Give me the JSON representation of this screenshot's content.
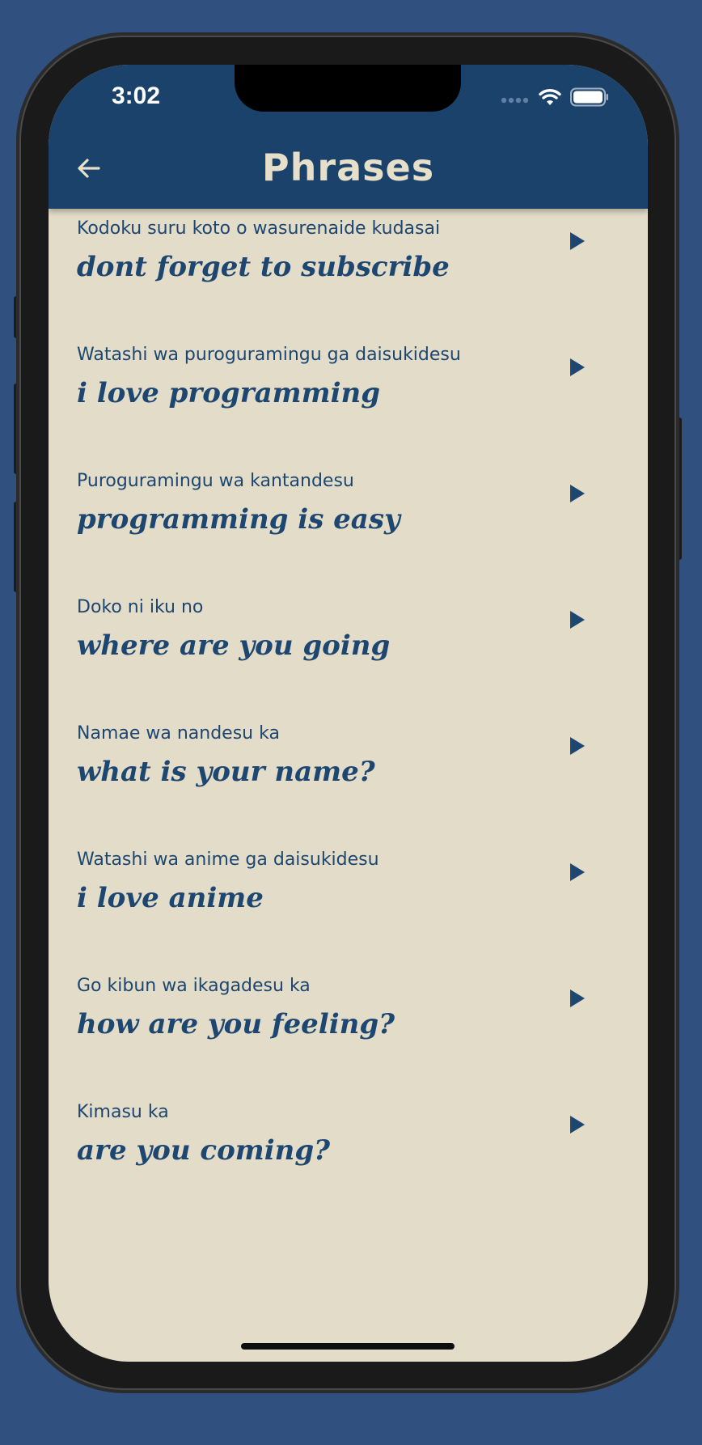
{
  "status_bar": {
    "time": "3:02"
  },
  "header": {
    "title": "Phrases",
    "back_icon": "arrow-left-icon"
  },
  "phrases": [
    {
      "romaji": "Kodoku suru koto o wasurenaide kudasai",
      "english": "dont forget to subscribe"
    },
    {
      "romaji": "Watashi wa puroguramingu ga daisukidesu",
      "english": "i love programming"
    },
    {
      "romaji": "Puroguramingu wa kantandesu",
      "english": "programming is easy"
    },
    {
      "romaji": "Doko ni iku no",
      "english": "where are you going"
    },
    {
      "romaji": "Namae wa nandesu ka",
      "english": "what is your name?"
    },
    {
      "romaji": "Watashi wa anime ga daisukidesu",
      "english": "i love anime"
    },
    {
      "romaji": "Go kibun wa ikagadesu ka",
      "english": "how are you feeling?"
    },
    {
      "romaji": "Kimasu ka",
      "english": "are you coming?"
    }
  ],
  "colors": {
    "background": "#30507f",
    "app_bar": "#1b426b",
    "screen": "#e3dcc8",
    "text": "#1d4670",
    "title": "#e6dfc9"
  }
}
